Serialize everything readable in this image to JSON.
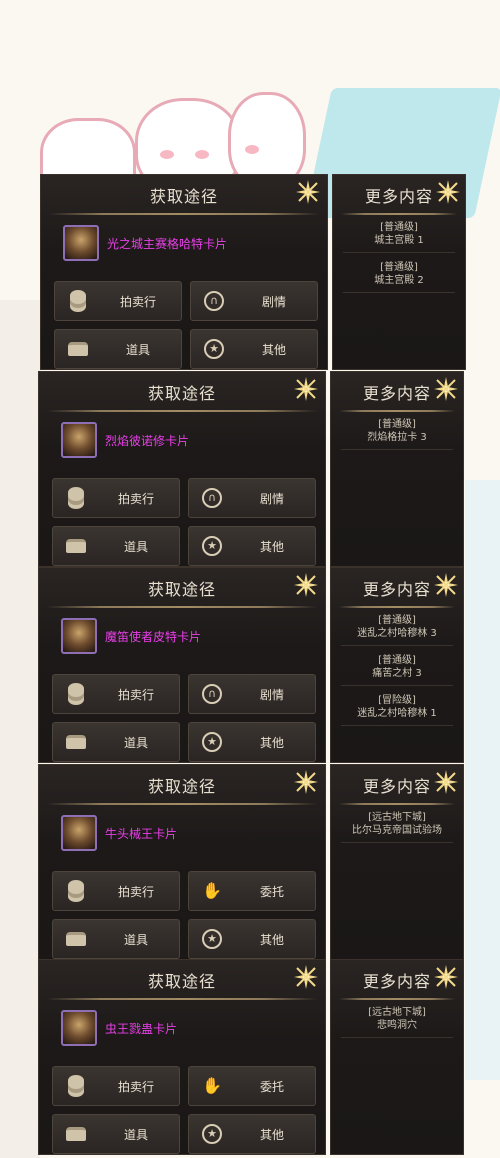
{
  "labels": {
    "left_title": "获取途径",
    "right_title": "更多内容"
  },
  "buttons": {
    "auction": "拍卖行",
    "story": "剧情",
    "items": "道具",
    "other": "其他",
    "commission": "委托"
  },
  "cards": [
    {
      "name": "光之城主赛格哈特卡片",
      "second_button": "story",
      "entries": [
        {
          "type": "[普通级]",
          "place": "城主宫殿 1"
        },
        {
          "type": "[普通级]",
          "place": "城主宫殿 2"
        }
      ]
    },
    {
      "name": "烈焰彼诺修卡片",
      "second_button": "story",
      "entries": [
        {
          "type": "[普通级]",
          "place": "烈焰格拉卡 3"
        }
      ]
    },
    {
      "name": "魔笛使者皮特卡片",
      "second_button": "story",
      "entries": [
        {
          "type": "[普通级]",
          "place": "迷乱之村哈穆林 3"
        },
        {
          "type": "[普通级]",
          "place": "痛苦之村 3"
        },
        {
          "type": "[冒险级]",
          "place": "迷乱之村哈穆林 1"
        }
      ]
    },
    {
      "name": "牛头械王卡片",
      "second_button": "commission",
      "entries": [
        {
          "type": "[远古地下城]",
          "place": "比尔马克帝国试验场"
        }
      ]
    },
    {
      "name": "虫王戮蛊卡片",
      "second_button": "commission",
      "entries": [
        {
          "type": "[远古地下城]",
          "place": "悲鸣洞穴"
        }
      ]
    }
  ],
  "colors": {
    "card_name": "#e93fe8",
    "panel_bg": "#1c1918",
    "text": "#e8e0d0"
  }
}
